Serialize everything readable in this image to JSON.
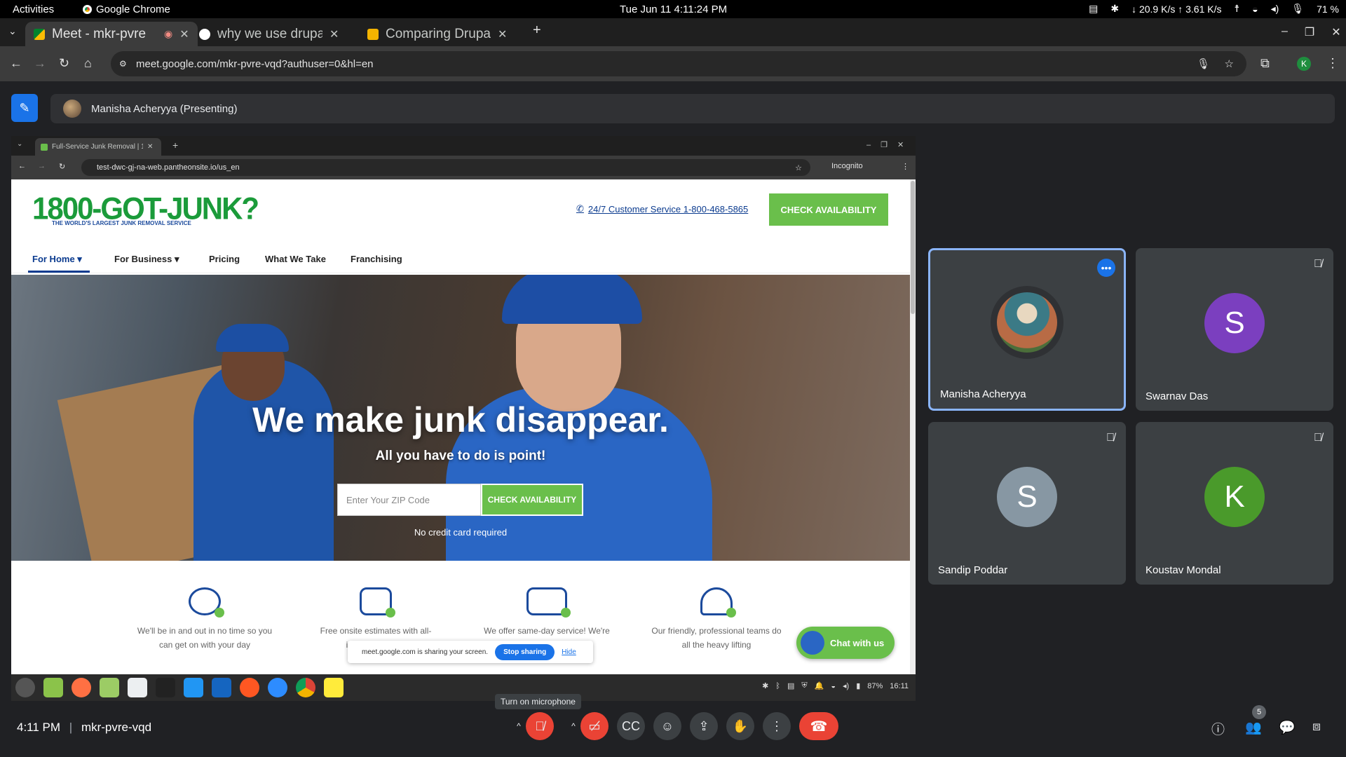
{
  "os_bar": {
    "activities": "Activities",
    "app_name": "Google Chrome",
    "clock": "Tue Jun 11   4:11:24 PM",
    "net_speed": "↓ 20.9 K/s ↑ 3.61 K/s",
    "battery": "71 %"
  },
  "browser": {
    "tabs": [
      {
        "title": "Meet - mkr-pvre",
        "active": true
      },
      {
        "title": "why we use drupal",
        "active": false
      },
      {
        "title": "Comparing Drupal",
        "active": false
      }
    ],
    "url": "meet.google.com/mkr-pvre-vqd?authuser=0&hl=en",
    "profile_initial": "K"
  },
  "meet": {
    "presenter_label": "Manisha Acheryya (Presenting)",
    "meeting_code": "mkr-pvre-vqd",
    "time": "4:11 PM",
    "tooltip": "Turn on microphone",
    "participant_count": "5",
    "participants": [
      {
        "name": "Manisha Acheryya",
        "initial": "",
        "color": "#2f3134",
        "speaking": true
      },
      {
        "name": "Swarnav Das",
        "initial": "S",
        "color": "#7b3fbf",
        "muted": true
      },
      {
        "name": "Sandip Poddar",
        "initial": "S",
        "color": "#8797a3",
        "muted": true
      },
      {
        "name": "Koustav Mondal",
        "initial": "K",
        "color": "#4a9a2b",
        "muted": true
      }
    ]
  },
  "shared_screen": {
    "tab_title": "Full-Service Junk Removal | 1-",
    "url": "test-dwc-gj-na-web.pantheonsite.io/us_en",
    "incognito": "Incognito",
    "logo_main": "1800-GOT-JUNK?",
    "logo_tag": "THE WORLD'S LARGEST JUNK REMOVAL SERVICE",
    "phone": "24/7 Customer Service 1-800-468-5865",
    "cta": "CHECK AVAILABILITY",
    "menu": [
      "For Home",
      "For Business",
      "Pricing",
      "What We Take",
      "Franchising"
    ],
    "hero_title": "We make junk disappear.",
    "hero_sub": "All you have to do is point!",
    "zip_placeholder": "Enter Your ZIP Code",
    "zip_button": "CHECK AVAILABILITY",
    "no_cc": "No credit card required",
    "features": [
      "We'll be in and out in no time so you can get on with your day",
      "Free onsite estimates with all-inclusive pricing",
      "We offer same-day service! We're",
      "Our friendly, professional teams do all the heavy lifting"
    ],
    "chat": "Chat with us",
    "sharing_notice": "meet.google.com is sharing your screen.",
    "stop_sharing": "Stop sharing",
    "hide": "Hide",
    "tray_battery": "87%",
    "tray_time": "16:11"
  }
}
